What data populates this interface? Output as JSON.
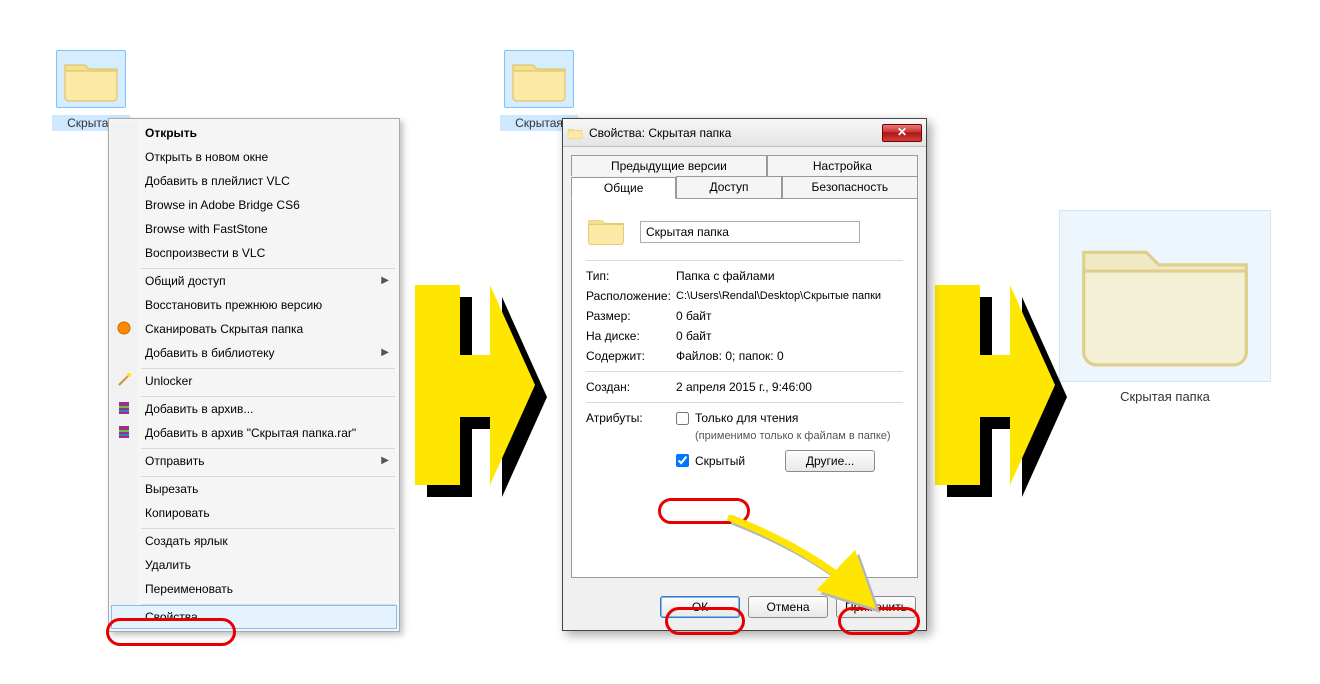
{
  "folders": {
    "leftSelected": "Скрытая",
    "centerSelected": "Скрытая",
    "right": "Скрытая папка"
  },
  "ctx": {
    "open": "Открыть",
    "openNew": "Открыть в новом окне",
    "addVlcPlaylist": "Добавить в плейлист VLC",
    "browseBridge": "Browse in Adobe Bridge CS6",
    "browseFastStone": "Browse with FastStone",
    "playVlc": "Воспроизвести в VLC",
    "share": "Общий доступ",
    "restore": "Восстановить прежнюю версию",
    "scan": "Сканировать Скрытая папка",
    "library": "Добавить в библиотеку",
    "unlocker": "Unlocker",
    "addArch": "Добавить в архив...",
    "addArchRar": "Добавить в архив \"Скрытая папка.rar\"",
    "send": "Отправить",
    "cut": "Вырезать",
    "copy": "Копировать",
    "shortcut": "Создать ярлык",
    "delete": "Удалить",
    "rename": "Переименовать",
    "props": "Свойства"
  },
  "dlg": {
    "title": "Свойства: Скрытая папка",
    "tabs": {
      "prev": "Предыдущие версии",
      "custom": "Настройка",
      "general": "Общие",
      "sharing": "Доступ",
      "security": "Безопасность"
    },
    "name": "Скрытая папка",
    "fields": {
      "typeK": "Тип:",
      "typeV": "Папка с файлами",
      "locK": "Расположение:",
      "locV": "C:\\Users\\Rendal\\Desktop\\Скрытые папки",
      "sizeK": "Размер:",
      "sizeV": "0 байт",
      "diskK": "На диске:",
      "diskV": "0 байт",
      "contK": "Содержит:",
      "contV": "Файлов: 0; папок: 0",
      "createdK": "Создан:",
      "createdV": "2 апреля 2015 г., 9:46:00",
      "attrK": "Атрибуты:"
    },
    "attrs": {
      "readonly": "Только для чтения",
      "readonlyNote": "(применимо только к файлам в папке)",
      "hidden": "Скрытый",
      "otherBtn": "Другие..."
    },
    "buttons": {
      "ok": "ОК",
      "cancel": "Отмена",
      "apply": "Применить"
    }
  }
}
